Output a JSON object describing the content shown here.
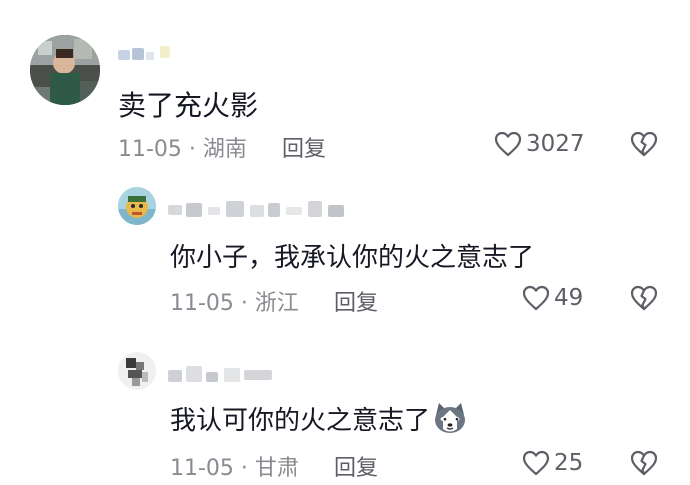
{
  "comments": [
    {
      "text": "卖了充火影",
      "date": "11-05",
      "location": "湖南",
      "reply_label": "回复",
      "likes": "3027"
    },
    {
      "text": "你小子，我承认你的火之意志了",
      "date": "11-05",
      "location": "浙江",
      "reply_label": "回复",
      "likes": "49"
    },
    {
      "text": "我认可你的火之意志了",
      "date": "11-05",
      "location": "甘肃",
      "reply_label": "回复",
      "likes": "25"
    }
  ],
  "separator": " · ",
  "icons": {
    "like": "heart-outline-icon",
    "dislike": "broken-heart-icon",
    "emoji": "husky-dog-emoji-icon"
  },
  "colors": {
    "text": "#161823",
    "meta": "#8a8b91",
    "action": "#5d5e66"
  }
}
